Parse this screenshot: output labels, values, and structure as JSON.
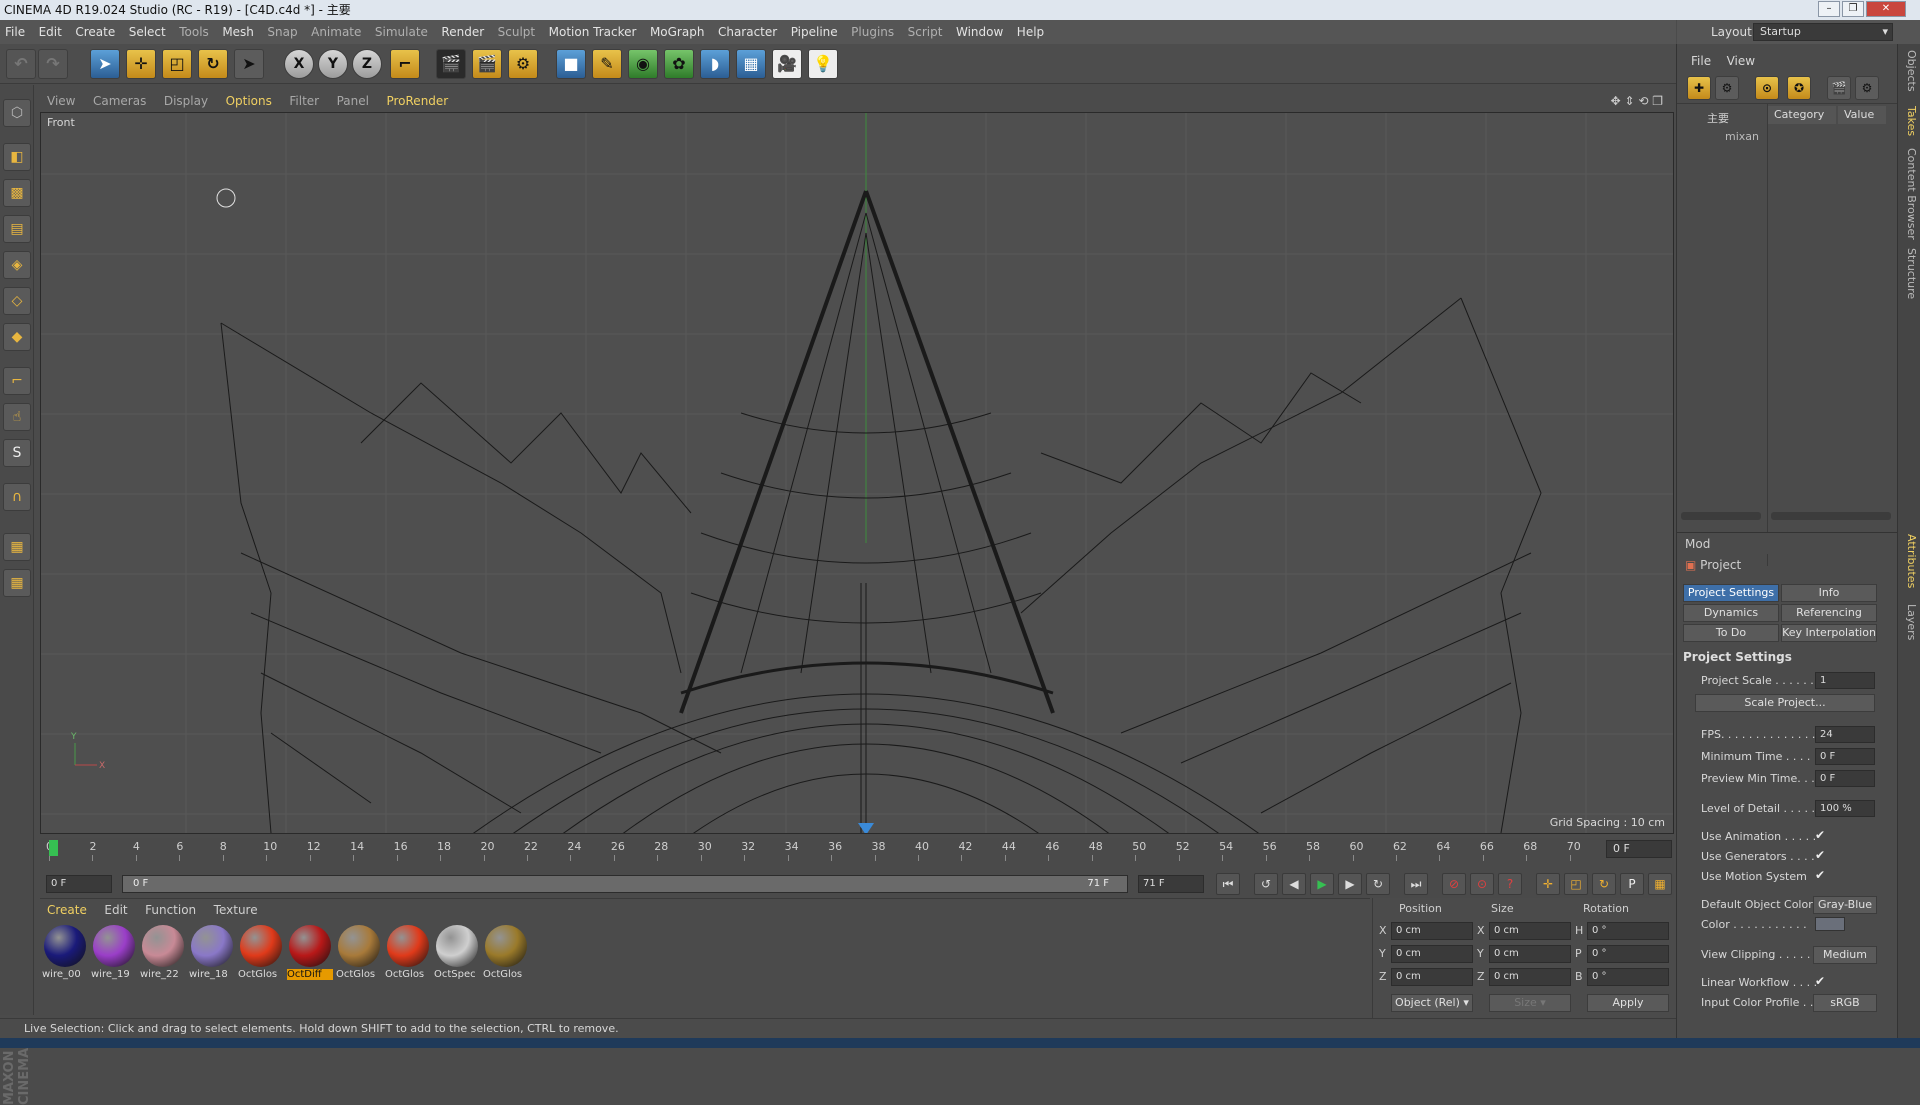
{
  "window": {
    "title": "CINEMA 4D R19.024 Studio (RC - R19) - [C4D.c4d *] - 主要"
  },
  "menu": [
    "File",
    "Edit",
    "Create",
    "Select",
    "Tools",
    "Mesh",
    "Snap",
    "Animate",
    "Simulate",
    "Render",
    "Sculpt",
    "Motion Tracker",
    "MoGraph",
    "Character",
    "Pipeline",
    "Plugins",
    "Script",
    "Window",
    "Help"
  ],
  "layout": {
    "label": "Layout:",
    "value": "Startup"
  },
  "toolbar": {
    "axis_x": "X",
    "axis_y": "Y",
    "axis_z": "Z"
  },
  "viewport": {
    "menu": [
      "View",
      "Cameras",
      "Display",
      "Options",
      "Filter",
      "Panel",
      "ProRender"
    ],
    "label": "Front",
    "grid_spacing": "Grid Spacing : 10 cm"
  },
  "timeline": {
    "ticks": [
      "0",
      "2",
      "4",
      "6",
      "8",
      "10",
      "12",
      "14",
      "16",
      "18",
      "20",
      "22",
      "24",
      "26",
      "28",
      "30",
      "32",
      "34",
      "36",
      "38",
      "40",
      "42",
      "44",
      "46",
      "48",
      "50",
      "52",
      "54",
      "56",
      "58",
      "60",
      "62",
      "64",
      "66",
      "68",
      "70"
    ],
    "current_frame": "0 F",
    "start_field": "0 F",
    "range_left": "0 F",
    "range_right": "71 F",
    "end_field": "71 F"
  },
  "materials": {
    "menu": [
      "Create",
      "Edit",
      "Function",
      "Texture"
    ],
    "items": [
      {
        "label": "wire_00",
        "color": "#1a1a7a"
      },
      {
        "label": "wire_19",
        "color": "#9a3ec8"
      },
      {
        "label": "wire_22",
        "color": "#c88a96"
      },
      {
        "label": "wire_18",
        "color": "#8a78c8"
      },
      {
        "label": "OctGlos",
        "color": "#e03a1a"
      },
      {
        "label": "OctDiff",
        "color": "#b81818"
      },
      {
        "label": "OctGlos",
        "color": "#a87a3a"
      },
      {
        "label": "OctGlos",
        "color": "#e03a1a"
      },
      {
        "label": "OctSpec",
        "color": "#cfcfcf"
      },
      {
        "label": "OctGlos",
        "color": "#9a7a2a"
      }
    ]
  },
  "coords": {
    "headers": [
      "Position",
      "Size",
      "Rotation"
    ],
    "rows": [
      {
        "axis": "X",
        "pos": "0 cm",
        "size_axis": "X",
        "size": "0 cm",
        "rot_axis": "H",
        "rot": "0 °"
      },
      {
        "axis": "Y",
        "pos": "0 cm",
        "size_axis": "Y",
        "size": "0 cm",
        "rot_axis": "P",
        "rot": "0 °"
      },
      {
        "axis": "Z",
        "pos": "0 cm",
        "size_axis": "Z",
        "size": "0 cm",
        "rot_axis": "B",
        "rot": "0 °"
      }
    ],
    "mode": "Object (Rel)",
    "size_mode": "Size",
    "apply": "Apply"
  },
  "status": "Live Selection: Click and drag to select elements. Hold down SHIFT to add to the selection, CTRL to remove.",
  "objects": {
    "menu": [
      "File",
      "View"
    ],
    "tree": [
      "主要",
      "mixan"
    ],
    "columns": [
      "Category",
      "Value"
    ]
  },
  "attributes": {
    "mode": "Mod",
    "title": "Project",
    "tabs": [
      "Project Settings",
      "Info",
      "Dynamics",
      "Referencing",
      "To Do",
      "Key Interpolation"
    ],
    "section": "Project Settings",
    "rows": {
      "scale_label": "Project Scale . . . . . .",
      "scale_val": "1",
      "scale_btn": "Scale Project...",
      "fps_label": "FPS. . . . . . . . . . . . . .",
      "fps_val": "24",
      "mintime_label": "Minimum Time . . . . .",
      "mintime_val": "0 F",
      "prevmin_label": "Preview Min Time. . .",
      "prevmin_val": "0 F",
      "lod_label": "Level of Detail . . . . .",
      "lod_val": "100 %",
      "useanim_label": "Use Animation . . . . .",
      "usegen_label": "Use Generators . . . .",
      "usemotion_label": "Use Motion System",
      "defcolor_label": "Default Object Color",
      "defcolor_val": "Gray-Blue",
      "color_label": "Color . . . . . . . . . . .",
      "clip_label": "View Clipping . . . . . .",
      "clip_val": "Medium",
      "linear_label": "Linear Workflow . . . .",
      "profile_label": "Input Color Profile . .",
      "profile_val": "sRGB"
    }
  },
  "side_tabs": [
    "Objects",
    "Takes",
    "Content Browser",
    "Structure",
    "Attributes",
    "Layers"
  ]
}
